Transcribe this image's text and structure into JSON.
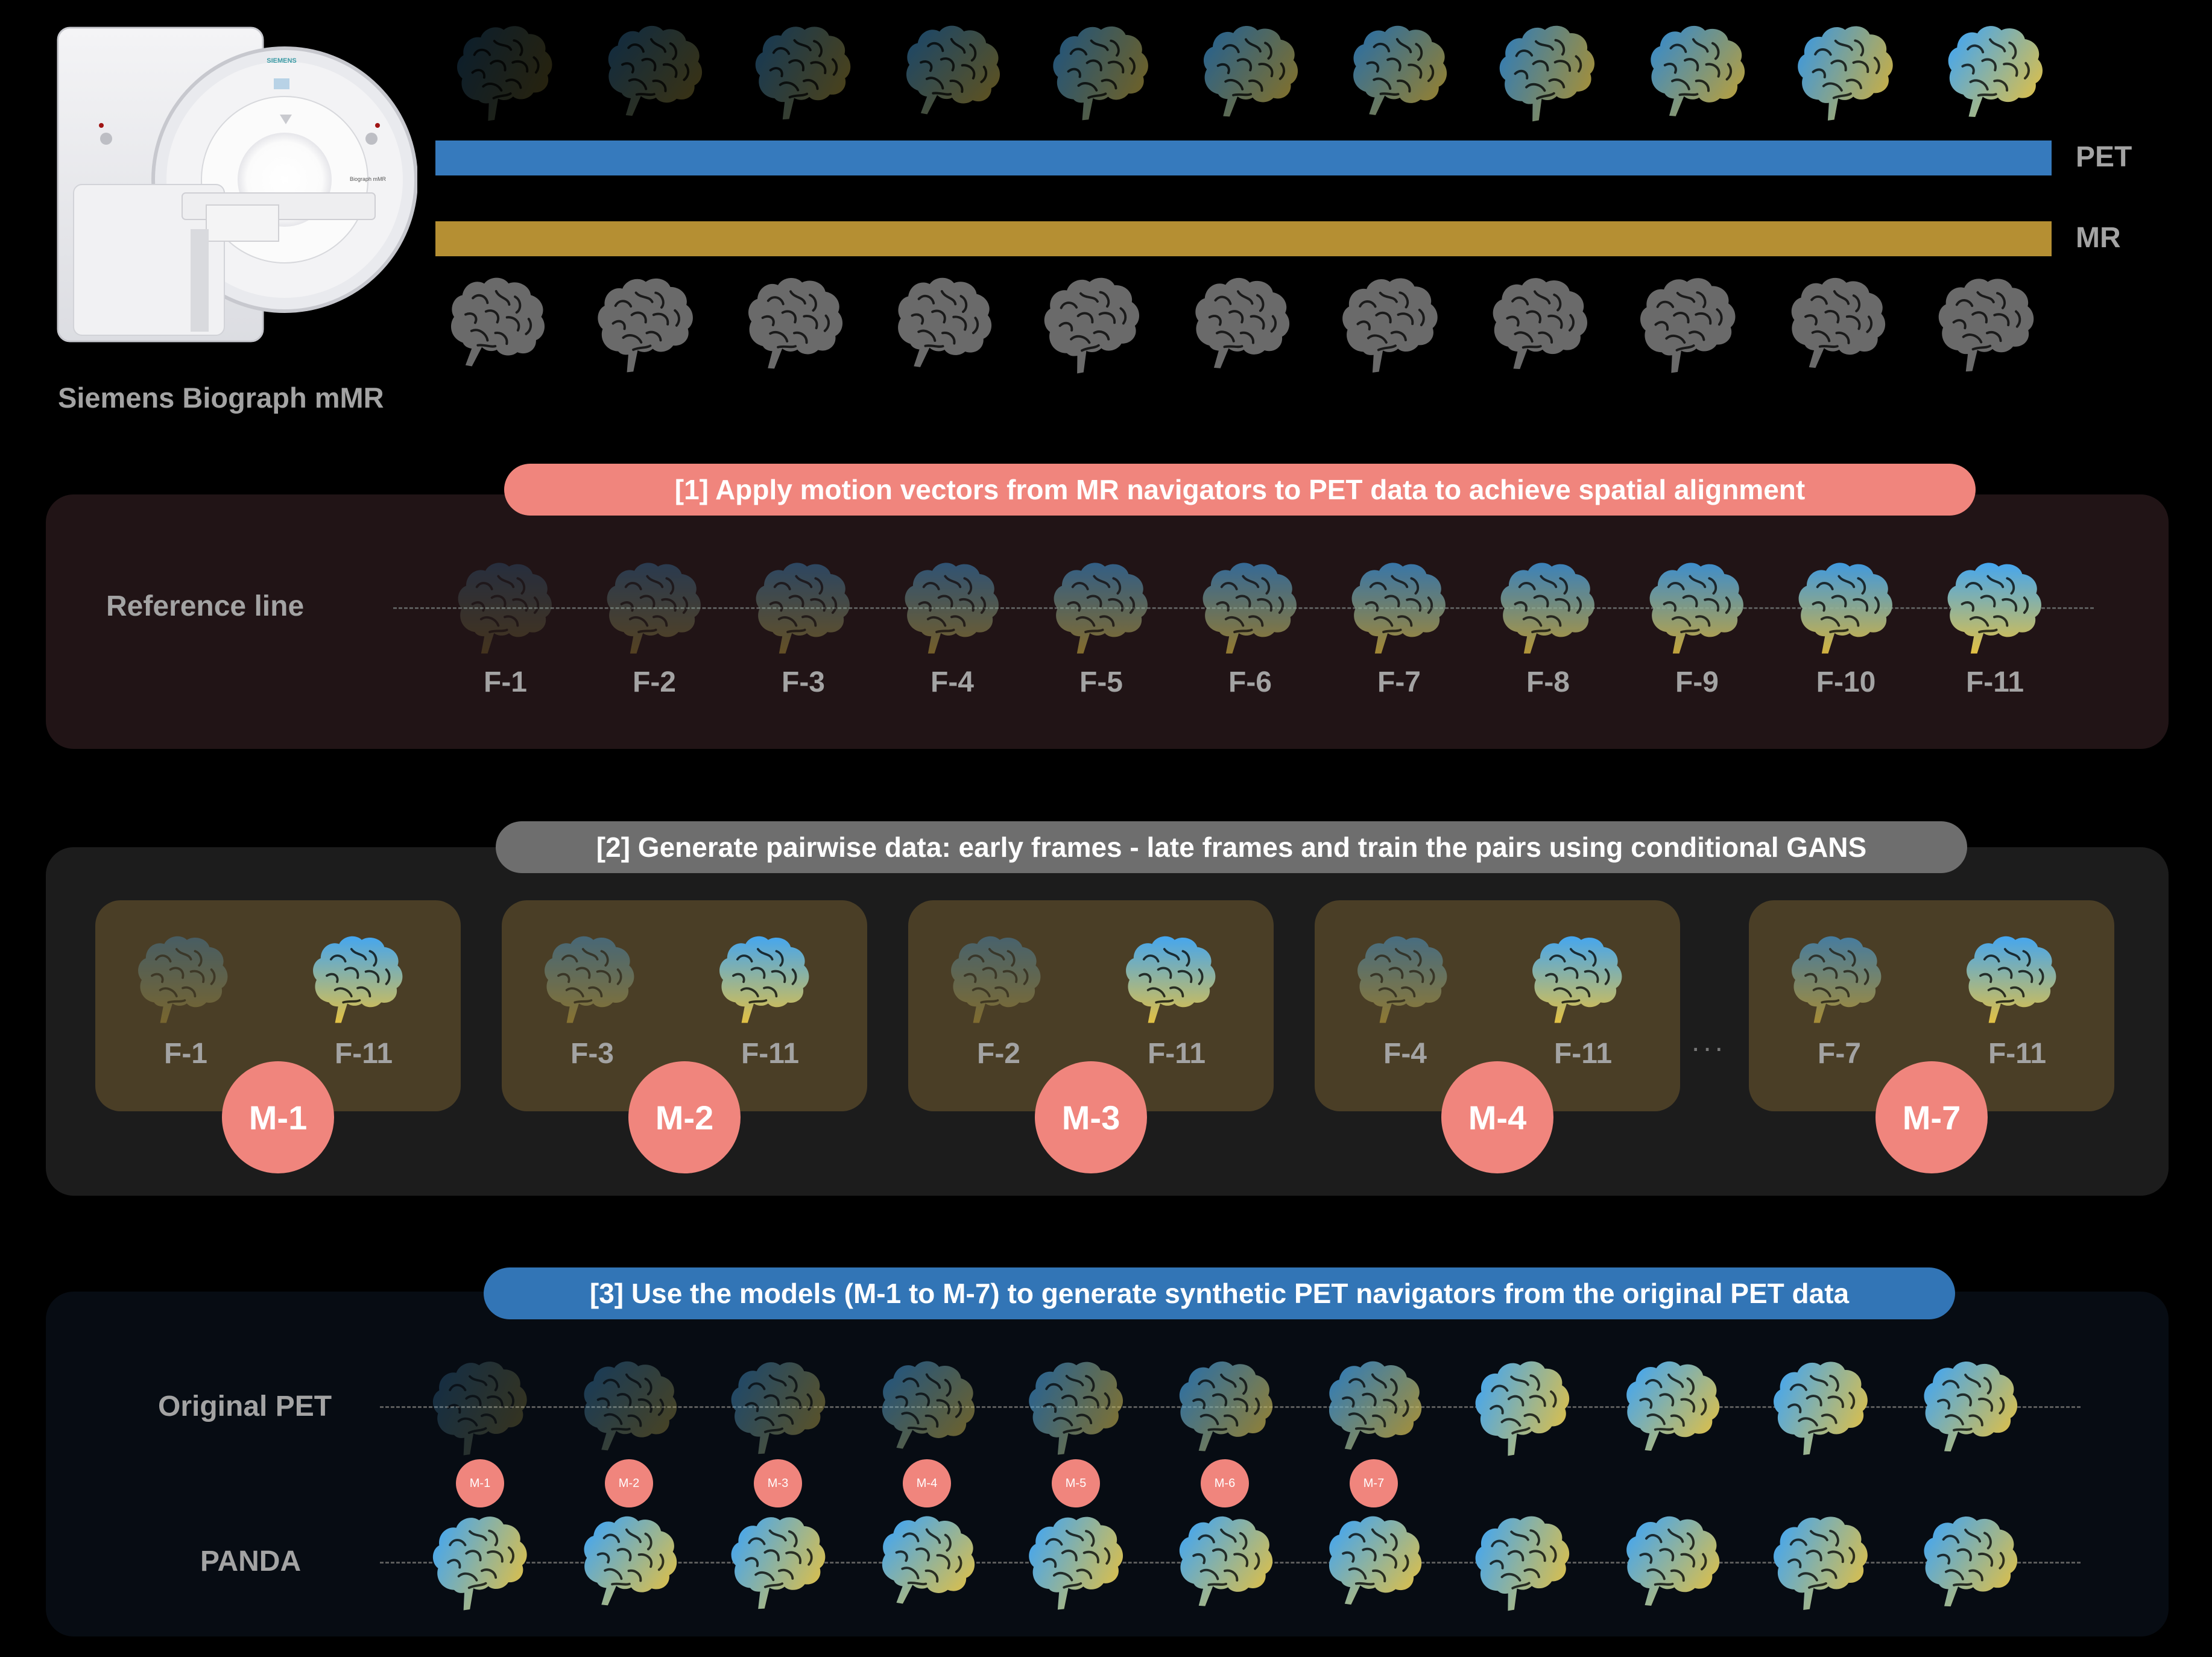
{
  "scanner": {
    "caption": "Siemens Biograph mMR",
    "brand_text": "SIEMENS",
    "model_text": "Biograph mMR"
  },
  "acquisition": {
    "pet_label": "PET",
    "mr_label": "MR",
    "pet_color": "#367abd",
    "mr_color": "#b58f33",
    "pet_frames": 11,
    "mr_frames": 11
  },
  "colors": {
    "pet_blue": "#44a6f0",
    "pet_gold": "#e2c043",
    "mr_gray": "#6a6a6a",
    "model_badge": "#f0857d"
  },
  "step1": {
    "title": "[1] Apply motion vectors from MR navigators to PET data to achieve spatial alignment",
    "row_label": "Reference line",
    "frames": [
      "F-1",
      "F-2",
      "F-3",
      "F-4",
      "F-5",
      "F-6",
      "F-7",
      "F-8",
      "F-9",
      "F-10",
      "F-11"
    ]
  },
  "step2": {
    "title": "[2] Generate pairwise data: early frames - late frames and train the pairs using conditional GANS",
    "ellipsis": "...",
    "pairs": [
      {
        "early": "F-1",
        "late": "F-11",
        "model": "M-1"
      },
      {
        "early": "F-3",
        "late": "F-11",
        "model": "M-2"
      },
      {
        "early": "F-2",
        "late": "F-11",
        "model": "M-3"
      },
      {
        "early": "F-4",
        "late": "F-11",
        "model": "M-4"
      },
      {
        "early": "F-7",
        "late": "F-11",
        "model": "M-7"
      }
    ]
  },
  "step3": {
    "title": "[3] Use the models (M-1 to M-7) to generate synthetic PET navigators from the original PET data",
    "original_label": "Original PET",
    "panda_label": "PANDA",
    "models": [
      "M-1",
      "M-2",
      "M-3",
      "M-4",
      "M-5",
      "M-6",
      "M-7"
    ],
    "frame_count": 11
  }
}
